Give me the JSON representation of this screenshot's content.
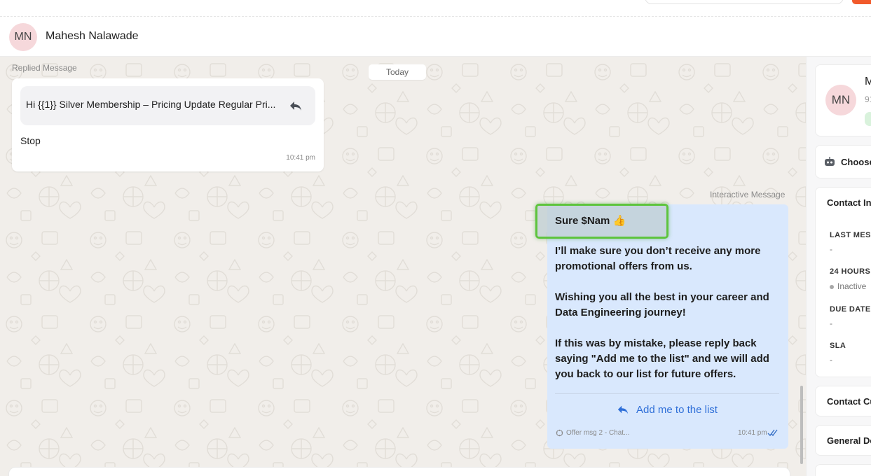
{
  "contact": {
    "initials": "MN",
    "name": "Mahesh Nalawade",
    "name_truncated": "M",
    "phone_truncated": "91"
  },
  "chat": {
    "date_separator": "Today",
    "incoming": {
      "label": "Replied Message",
      "quoted_text": "Hi {{1}} Silver Membership – Pricing Update Regular Pri...",
      "text": "Stop",
      "time": "10:41 pm"
    },
    "outgoing": {
      "label": "Interactive Message",
      "header": "Sure $Nam 👍",
      "paragraphs": [
        "I’ll make sure you don’t receive any more promotional offers from us.",
        "Wishing you all the best in your career and Data Engineering journey!",
        "If this was by mistake, please reply back saying \"Add me to the list\" and we will add you back to our list for future offers."
      ],
      "action_label": "Add me to the list",
      "template_name": "Offer msg 2 - Chat...",
      "time": "10:41 pm",
      "status": "read"
    }
  },
  "right_panel": {
    "chatbot_label": "Choose",
    "contact_info_title": "Contact In",
    "fields": [
      {
        "label": "LAST MES",
        "value": "-"
      },
      {
        "label": "24 HOURS",
        "value": "Inactive"
      },
      {
        "label": "DUE DATE",
        "value": "-"
      },
      {
        "label": "SLA",
        "value": "-"
      }
    ],
    "contact_custom_title": "Contact Cu",
    "general_details_title": "General De"
  },
  "colors": {
    "outgoing_bubble": "#d9e8fd",
    "action_link": "#2f6fd8",
    "highlight_border": "#5ec43d",
    "avatar_bg": "#f6d8db",
    "chat_bg": "#f1eeea",
    "top_cta": "#f15a2b"
  },
  "icons": [
    "reply-icon",
    "template-icon",
    "double-check-icon",
    "bot-icon"
  ]
}
